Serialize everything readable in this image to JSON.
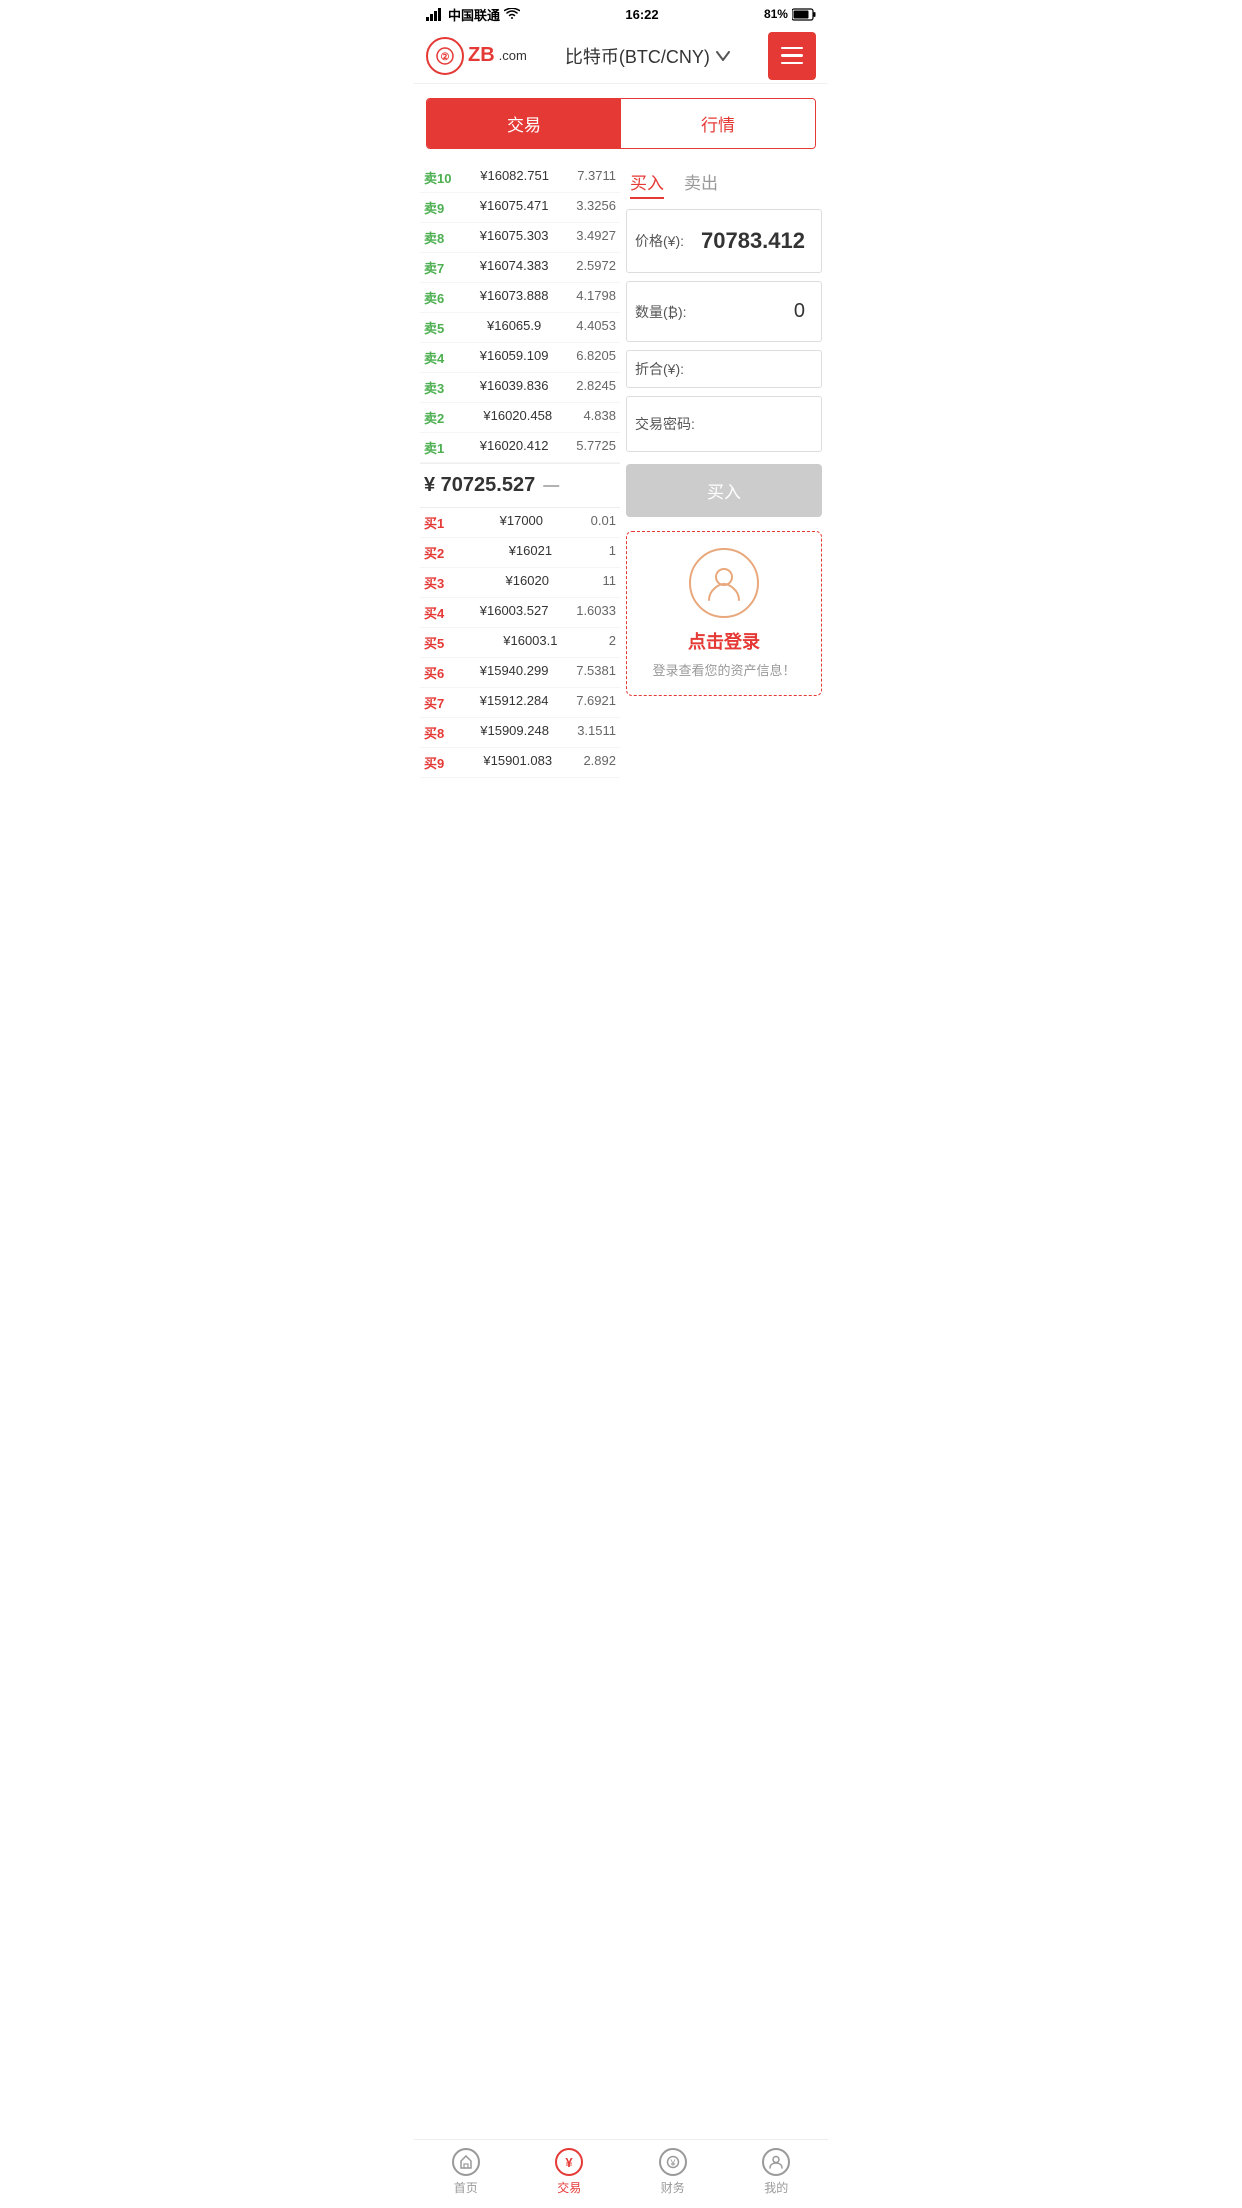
{
  "statusBar": {
    "carrier": "中国联通",
    "time": "16:22",
    "battery": "81%"
  },
  "header": {
    "logoText": "ZB",
    "logoDomain": ".com",
    "title": "比特币(BTC/CNY)",
    "menuAriaLabel": "菜单"
  },
  "tabs": {
    "tab1": "交易",
    "tab2": "行情",
    "activeTab": "tab1"
  },
  "orderBook": {
    "sellOrders": [
      {
        "label": "卖10",
        "price": "¥16082.751",
        "qty": "7.3711"
      },
      {
        "label": "卖9",
        "price": "¥16075.471",
        "qty": "3.3256"
      },
      {
        "label": "卖8",
        "price": "¥16075.303",
        "qty": "3.4927"
      },
      {
        "label": "卖7",
        "price": "¥16074.383",
        "qty": "2.5972"
      },
      {
        "label": "卖6",
        "price": "¥16073.888",
        "qty": "4.1798"
      },
      {
        "label": "卖5",
        "price": "¥16065.9",
        "qty": "4.4053"
      },
      {
        "label": "卖4",
        "price": "¥16059.109",
        "qty": "6.8205"
      },
      {
        "label": "卖3",
        "price": "¥16039.836",
        "qty": "2.8245"
      },
      {
        "label": "卖2",
        "price": "¥16020.458",
        "qty": "4.838"
      },
      {
        "label": "卖1",
        "price": "¥16020.412",
        "qty": "5.7725"
      }
    ],
    "midPrice": "¥ 70725.527",
    "midPriceArrow": "—",
    "buyOrders": [
      {
        "label": "买1",
        "price": "¥17000",
        "qty": "0.01"
      },
      {
        "label": "买2",
        "price": "¥16021",
        "qty": "1"
      },
      {
        "label": "买3",
        "price": "¥16020",
        "qty": "11"
      },
      {
        "label": "买4",
        "price": "¥16003.527",
        "qty": "1.6033"
      },
      {
        "label": "买5",
        "price": "¥16003.1",
        "qty": "2"
      },
      {
        "label": "买6",
        "price": "¥15940.299",
        "qty": "7.5381"
      },
      {
        "label": "买7",
        "price": "¥15912.284",
        "qty": "7.6921"
      },
      {
        "label": "买8",
        "price": "¥15909.248",
        "qty": "3.1511"
      },
      {
        "label": "买9",
        "price": "¥15901.083",
        "qty": "2.892"
      }
    ]
  },
  "tradePanel": {
    "buyTab": "买入",
    "sellTab": "卖出",
    "activeTab": "buy",
    "priceLabel": "价格(¥):",
    "priceValue": "70783.412",
    "qtyLabel": "数量(₿):",
    "qtyValue": "0",
    "totalLabel": "折合(¥):",
    "totalValue": "",
    "passwordLabel": "交易密码:",
    "passwordValue": "",
    "buyButton": "买入"
  },
  "loginBox": {
    "loginText": "点击登录",
    "loginDesc": "登录查看您的资产信息！"
  },
  "bottomNav": {
    "items": [
      {
        "label": "首页",
        "icon": "★",
        "active": false
      },
      {
        "label": "交易",
        "icon": "¥",
        "active": true
      },
      {
        "label": "财务",
        "icon": "◎",
        "active": false
      },
      {
        "label": "我的",
        "icon": "👤",
        "active": false
      }
    ]
  }
}
